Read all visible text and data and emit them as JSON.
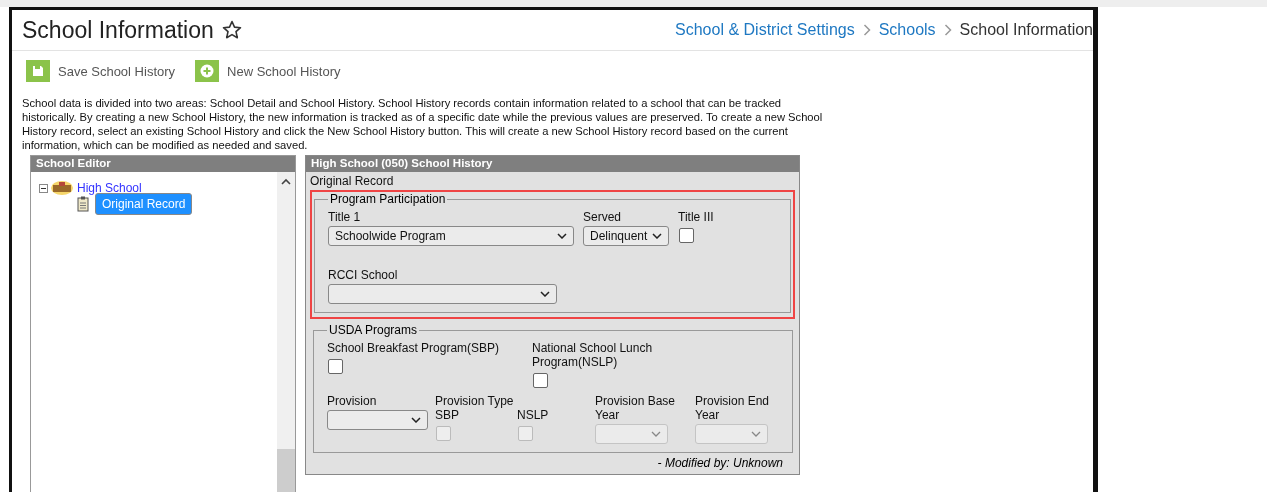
{
  "header": {
    "title": "School Information",
    "favorite": false,
    "breadcrumbs": [
      {
        "label": "School & District Settings",
        "link": true
      },
      {
        "label": "Schools",
        "link": true
      },
      {
        "label": "School Information",
        "link": false
      }
    ]
  },
  "toolbar": [
    {
      "label": "Save School History"
    },
    {
      "label": "New School History"
    }
  ],
  "description": "School data is divided into two areas: School Detail and School History. School History records contain information related to a school that can be tracked historically. By creating a new School History, the new information is tracked as of a specific date while the previous values are preserved. To create a new School History record, select an existing School History and click the New School History button. This will create a new School History record based on the current information, which can be modified as needed and saved.",
  "tree": {
    "title": "School Editor",
    "items": [
      {
        "label": "High School",
        "expanded": true,
        "selected": false,
        "children": [
          {
            "label": "Original Record",
            "selected": true
          }
        ]
      }
    ]
  },
  "detail": {
    "title": "High School (050) School History",
    "subtitle": "Original Record",
    "program_participation": {
      "legend": "Program Participation",
      "highlighted": true,
      "title1": {
        "label": "Title 1",
        "value": "Schoolwide Program"
      },
      "served": {
        "label": "Served",
        "value": "Delinquent"
      },
      "title3": {
        "label": "Title III",
        "checked": false
      },
      "rcci": {
        "label": "RCCI School"
      }
    },
    "usda": {
      "legend": "USDA Programs",
      "sbp": {
        "label": "School Breakfast Program(SBP)",
        "checked": false
      },
      "nslp": {
        "label": "National School Lunch Program(NSLP)",
        "checked": false
      },
      "provision": {
        "label": "Provision"
      },
      "provision_type_sbp": {
        "label": "Provision Type SBP",
        "checked": false,
        "disabled": true
      },
      "provision_type_nslp": {
        "label": "NSLP",
        "checked": false,
        "disabled": true
      },
      "base_year": {
        "label": "Provision Base Year",
        "disabled": true
      },
      "end_year": {
        "label": "Provision End Year",
        "disabled": true
      }
    },
    "modified": "- Modified by: Unknown"
  }
}
